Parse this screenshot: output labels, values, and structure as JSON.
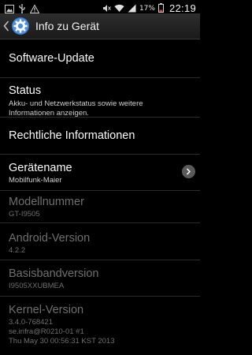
{
  "status_bar": {
    "battery_percent": "17%",
    "time": "22:19",
    "icons": [
      "gallery-icon",
      "usb-icon",
      "warning-icon",
      "mute-icon",
      "wifi-icon",
      "signal-icon",
      "battery-icon"
    ]
  },
  "action_bar": {
    "title": "Info zu Gerät",
    "icon": "settings-gear-icon"
  },
  "items": [
    {
      "title": "Software-Update",
      "subtitle": ""
    },
    {
      "title": "Status",
      "subtitle": "Akku- und Netzwerkstatus sowie weitere Informationen anzeigen."
    },
    {
      "title": "Rechtliche Informationen",
      "subtitle": ""
    },
    {
      "title": "Gerätename",
      "subtitle": "Mobilfunk-Maier"
    },
    {
      "title": "Modellnummer",
      "subtitle": "GT-I9505"
    },
    {
      "title": "Android-Version",
      "subtitle": "4.2.2"
    },
    {
      "title": "Basisbandversion",
      "subtitle": "I9505XXUBMEA"
    },
    {
      "title": "Kernel-Version",
      "subtitle_lines": [
        "3.4.0-768421",
        "se.infra@R0210-01 #1",
        "Thu May 30 00:56:31 KST 2013"
      ]
    }
  ],
  "colors": {
    "background": "#000000",
    "divider": "#2c2c2c",
    "disabled_text": "#6f6f6f",
    "action_bar": "#222222"
  }
}
